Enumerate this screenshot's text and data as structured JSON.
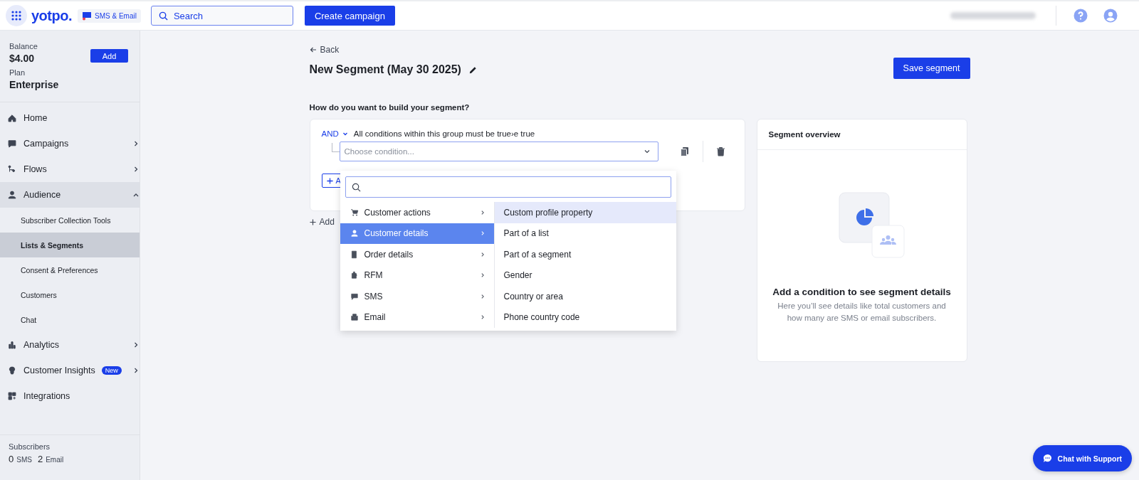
{
  "top_bar": {
    "logo": "yotpo.",
    "product_badge": "SMS & Email",
    "search": {
      "placeholder": "Search"
    },
    "create_button": "Create campaign"
  },
  "sidebar": {
    "balance_label": "Balance",
    "balance": "$4.00",
    "add_button": "Add",
    "plan_label": "Plan",
    "plan": "Enterprise",
    "items": [
      {
        "label": "Home",
        "kind": "link",
        "selected": false
      },
      {
        "label": "Campaigns",
        "kind": "group",
        "expanded": false,
        "selected": false
      },
      {
        "label": "Flows",
        "kind": "group",
        "expanded": false,
        "selected": false
      },
      {
        "label": "Audience",
        "kind": "group",
        "expanded": true,
        "selected": true,
        "children": [
          {
            "label": "Subscriber Collection Tools",
            "selected": false
          },
          {
            "label": "Lists & Segments",
            "selected": true
          },
          {
            "label": "Consent & Preferences",
            "selected": false
          },
          {
            "label": "Customers",
            "selected": false
          },
          {
            "label": "Chat",
            "selected": false
          }
        ]
      },
      {
        "label": "Analytics",
        "kind": "group",
        "expanded": false,
        "selected": false
      },
      {
        "label": "Customer Insights",
        "kind": "group",
        "expanded": false,
        "selected": false,
        "badge": "New"
      },
      {
        "label": "Integrations",
        "kind": "link",
        "selected": false
      }
    ],
    "subscribers": {
      "label": "Subscribers",
      "sms_count": "0",
      "sms_label": "SMS",
      "email_count": "2",
      "email_label": "Email"
    }
  },
  "main": {
    "back": "Back",
    "title": "New Segment (May 30 2025)",
    "save_button": "Save segment",
    "question": "How do you want to build your segment?",
    "condition_group": {
      "operator": "AND",
      "description": "All conditions within this group must be true›e true",
      "condition_placeholder": "Choose condition...",
      "add_condition_button": "A",
      "add_group": "Add"
    },
    "dropdown": {
      "categories": [
        {
          "label": "Customer actions",
          "selected": false
        },
        {
          "label": "Customer details",
          "selected": true
        },
        {
          "label": "Order details",
          "selected": false
        },
        {
          "label": "RFM",
          "selected": false
        },
        {
          "label": "SMS",
          "selected": false
        },
        {
          "label": "Email",
          "selected": false
        }
      ],
      "options": [
        {
          "label": "Custom profile property",
          "selected": true
        },
        {
          "label": "Part of a list",
          "selected": false
        },
        {
          "label": "Part of a segment",
          "selected": false
        },
        {
          "label": "Gender",
          "selected": false
        },
        {
          "label": "Country or area",
          "selected": false
        },
        {
          "label": "Phone country code",
          "selected": false
        }
      ]
    },
    "overview": {
      "title": "Segment overview",
      "empty_title": "Add a condition to see segment details",
      "empty_text": "Here you’ll see details like total customers and how many are SMS or email subscribers."
    }
  },
  "chat_button": "Chat with Support"
}
